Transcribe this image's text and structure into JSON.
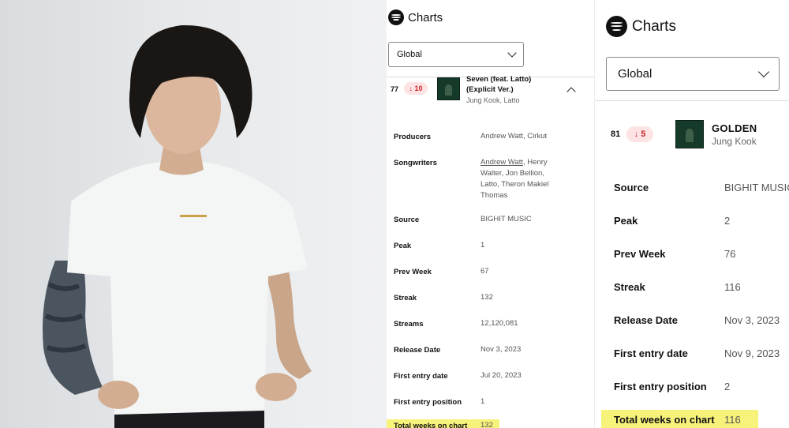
{
  "accent_color": "#1DB954",
  "trend_color": "#c8282d",
  "highlight_color": "#f7f27a",
  "panel_left": {
    "brand": "Charts",
    "region": "Global",
    "entry": {
      "rank": "77",
      "change": "10",
      "change_direction": "down",
      "title_line1": "Seven (feat. Latto)",
      "title_line2": "(Explicit Ver.)",
      "artists": "Jung Kook, Latto"
    },
    "labels": {
      "producers": "Producers",
      "songwriters": "Songwriters",
      "source": "Source",
      "peak": "Peak",
      "prev_week": "Prev Week",
      "streak": "Streak",
      "streams": "Streams",
      "release_date": "Release Date",
      "first_entry_date": "First entry date",
      "first_entry_position": "First entry position",
      "total_weeks": "Total weeks on chart"
    },
    "values": {
      "producers": "Andrew Watt, Cirkut",
      "songwriter_linked": "Andrew Watt",
      "songwriters_rest_1": ", Henry",
      "songwriters_rest_2": "Walter, Jon Bellion,",
      "songwriters_rest_3": "Latto, Theron Makiel",
      "songwriters_rest_4": "Thomas",
      "source": "BIGHIT MUSIC",
      "peak": "1",
      "prev_week": "67",
      "streak": "132",
      "streams": "12,120,081",
      "release_date": "Nov 3, 2023",
      "first_entry_date": "Jul 20, 2023",
      "first_entry_position": "1",
      "total_weeks": "132"
    }
  },
  "panel_right": {
    "brand": "Charts",
    "region": "Global",
    "entry": {
      "rank": "81",
      "change": "5",
      "change_direction": "down",
      "title": "GOLDEN",
      "artists": "Jung Kook"
    },
    "labels": {
      "source": "Source",
      "peak": "Peak",
      "prev_week": "Prev Week",
      "streak": "Streak",
      "release_date": "Release Date",
      "first_entry_date": "First entry date",
      "first_entry_position": "First entry position",
      "total_weeks": "Total weeks on chart"
    },
    "values": {
      "source": "BIGHIT MUSIC",
      "peak": "2",
      "prev_week": "76",
      "streak": "116",
      "release_date": "Nov 3, 2023",
      "first_entry_date": "Nov 9, 2023",
      "first_entry_position": "2",
      "total_weeks": "116"
    }
  }
}
